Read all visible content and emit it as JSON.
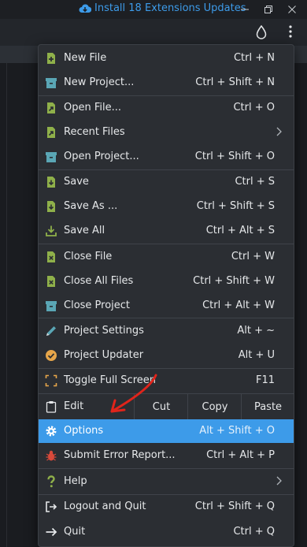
{
  "titlebar": {
    "updates_label": "Install 18 Extensions Updates"
  },
  "menu": {
    "items": [
      {
        "label": "New File",
        "shortcut": "Ctrl + N"
      },
      {
        "label": "New Project...",
        "shortcut": "Ctrl + Shift + N"
      },
      {
        "label": "Open File...",
        "shortcut": "Ctrl + O"
      },
      {
        "label": "Recent Files",
        "shortcut": ""
      },
      {
        "label": "Open Project...",
        "shortcut": "Ctrl + Shift + O"
      },
      {
        "label": "Save",
        "shortcut": "Ctrl + S"
      },
      {
        "label": "Save As ...",
        "shortcut": "Ctrl + Shift + S"
      },
      {
        "label": "Save All",
        "shortcut": "Ctrl + Alt + S"
      },
      {
        "label": "Close File",
        "shortcut": "Ctrl + W"
      },
      {
        "label": "Close All Files",
        "shortcut": "Ctrl + Shift + W"
      },
      {
        "label": "Close Project",
        "shortcut": "Ctrl + Alt + W"
      },
      {
        "label": "Project Settings",
        "shortcut": "Alt + ~"
      },
      {
        "label": "Project Updater",
        "shortcut": "Alt + U"
      },
      {
        "label": "Toggle Full Screen",
        "shortcut": "F11"
      },
      {
        "label": "Options",
        "shortcut": "Alt + Shift + O"
      },
      {
        "label": "Submit Error Report...",
        "shortcut": "Ctrl + Alt + P"
      },
      {
        "label": "Help",
        "shortcut": ""
      },
      {
        "label": "Logout and Quit",
        "shortcut": "Ctrl + Shift + Q"
      },
      {
        "label": "Quit",
        "shortcut": "Ctrl + Q"
      }
    ],
    "edit": {
      "label": "Edit",
      "cut": "Cut",
      "copy": "Copy",
      "paste": "Paste"
    }
  },
  "colors": {
    "accent": "#3d9be9",
    "menu_bg": "#2b2e33",
    "icon_green": "#8fb04a",
    "icon_teal": "#5aa6b5",
    "icon_orange": "#e7a64a",
    "icon_red": "#d9493a",
    "annotation_red": "#e0241b"
  }
}
